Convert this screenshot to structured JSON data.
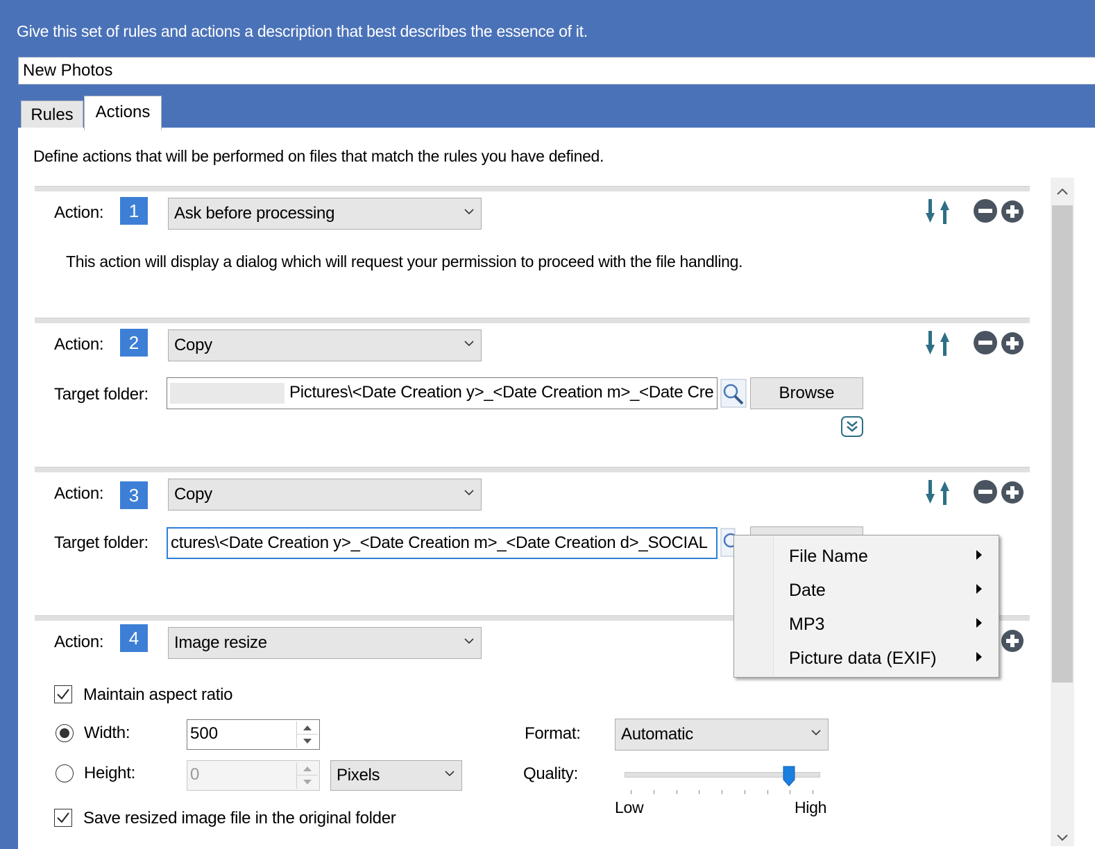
{
  "header": {
    "prompt": "Give this set of rules and actions a description that best describes the essence of it.",
    "description_value": "New Photos"
  },
  "tabs": [
    {
      "label": "Rules"
    },
    {
      "label": "Actions"
    }
  ],
  "panel": {
    "intro": "Define actions that will be performed on files that match the rules you have defined."
  },
  "common": {
    "action_label": "Action:",
    "target_folder_label": "Target folder:",
    "browse_label": "Browse"
  },
  "actions": [
    {
      "number": "1",
      "type": "Ask before processing",
      "description": "This action will display a dialog which will request your permission to proceed with the file handling."
    },
    {
      "number": "2",
      "type": "Copy",
      "target_folder": "Pictures\\<Date Creation y>_<Date Creation m>_<Date Cre"
    },
    {
      "number": "3",
      "type": "Copy",
      "target_folder": "ctures\\<Date Creation y>_<Date Creation m>_<Date Creation d>_SOCIAL"
    },
    {
      "number": "4",
      "type": "Image resize",
      "maintain_aspect_label": "Maintain aspect ratio",
      "maintain_aspect_checked": true,
      "width_label": "Width:",
      "width_value": "500",
      "width_selected": true,
      "height_label": "Height:",
      "height_value": "0",
      "unit": "Pixels",
      "format_label": "Format:",
      "format_value": "Automatic",
      "quality_label": "Quality:",
      "quality_low": "Low",
      "quality_high": "High",
      "quality_level": 0.87,
      "save_original_label": "Save resized image file in the original folder",
      "save_original_checked": true
    }
  ],
  "context_menu": {
    "items": [
      {
        "label": "File Name"
      },
      {
        "label": "Date"
      },
      {
        "label": "MP3"
      },
      {
        "label": "Picture data (EXIF)"
      }
    ]
  },
  "colors": {
    "header_bg": "#4a72b8",
    "accent_blue": "#3d7fd6",
    "icon_teal": "#2e6f86"
  },
  "icons": [
    "move-down-icon",
    "move-up-icon",
    "remove-action-icon",
    "add-action-icon",
    "search-icon",
    "expand-more-icon",
    "scroll-up-icon",
    "scroll-down-icon"
  ]
}
